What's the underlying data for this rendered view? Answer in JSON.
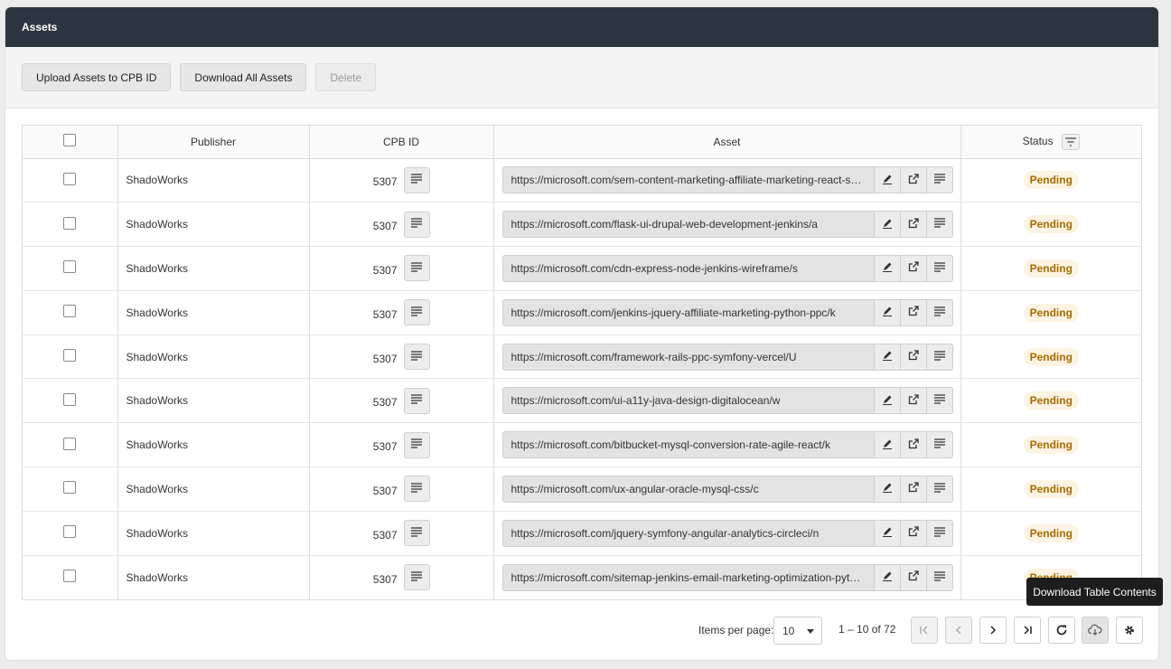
{
  "header": {
    "title": "Assets"
  },
  "toolbar": {
    "upload_label": "Upload Assets to CPB ID",
    "download_all_label": "Download All Assets",
    "delete_label": "Delete"
  },
  "table": {
    "columns": [
      "Publisher",
      "CPB ID",
      "Asset",
      "Status"
    ],
    "rows": [
      {
        "publisher": "ShadoWorks",
        "cpb_id": "5307",
        "asset": "https://microsoft.com/sem-content-marketing-affiliate-marketing-react-ser...",
        "status": "Pending"
      },
      {
        "publisher": "ShadoWorks",
        "cpb_id": "5307",
        "asset": "https://microsoft.com/flask-ui-drupal-web-development-jenkins/a",
        "status": "Pending"
      },
      {
        "publisher": "ShadoWorks",
        "cpb_id": "5307",
        "asset": "https://microsoft.com/cdn-express-node-jenkins-wireframe/s",
        "status": "Pending"
      },
      {
        "publisher": "ShadoWorks",
        "cpb_id": "5307",
        "asset": "https://microsoft.com/jenkins-jquery-affiliate-marketing-python-ppc/k",
        "status": "Pending"
      },
      {
        "publisher": "ShadoWorks",
        "cpb_id": "5307",
        "asset": "https://microsoft.com/framework-rails-ppc-symfony-vercel/U",
        "status": "Pending"
      },
      {
        "publisher": "ShadoWorks",
        "cpb_id": "5307",
        "asset": "https://microsoft.com/ui-a11y-java-design-digitalocean/w",
        "status": "Pending"
      },
      {
        "publisher": "ShadoWorks",
        "cpb_id": "5307",
        "asset": "https://microsoft.com/bitbucket-mysql-conversion-rate-agile-react/k",
        "status": "Pending"
      },
      {
        "publisher": "ShadoWorks",
        "cpb_id": "5307",
        "asset": "https://microsoft.com/ux-angular-oracle-mysql-css/c",
        "status": "Pending"
      },
      {
        "publisher": "ShadoWorks",
        "cpb_id": "5307",
        "asset": "https://microsoft.com/jquery-symfony-angular-analytics-circleci/n",
        "status": "Pending"
      },
      {
        "publisher": "ShadoWorks",
        "cpb_id": "5307",
        "asset": "https://microsoft.com/sitemap-jenkins-email-marketing-optimization-pytho...",
        "status": "Pending"
      }
    ]
  },
  "paginator": {
    "items_per_page_label": "Items per page:",
    "items_per_page": "10",
    "range": "1 – 10 of 72"
  },
  "tooltip": {
    "text": "Download Table Contents"
  },
  "colors": {
    "header_bg": "#2b3640",
    "status_pending": "#a86b00"
  }
}
